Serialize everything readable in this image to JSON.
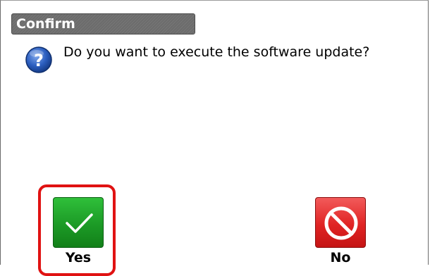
{
  "dialog": {
    "title": "Confirm",
    "message": "Do you want to execute the software update?",
    "icon": "question-icon"
  },
  "buttons": {
    "yes": {
      "label": "Yes",
      "icon": "checkmark-icon",
      "color": "#1c9a26",
      "focused": true
    },
    "no": {
      "label": "No",
      "icon": "prohibited-icon",
      "color": "#e02424"
    }
  },
  "colors": {
    "focus_ring": "#e01212",
    "title_bar": "#6c6c6c",
    "question_icon": "#1e4fa8"
  }
}
